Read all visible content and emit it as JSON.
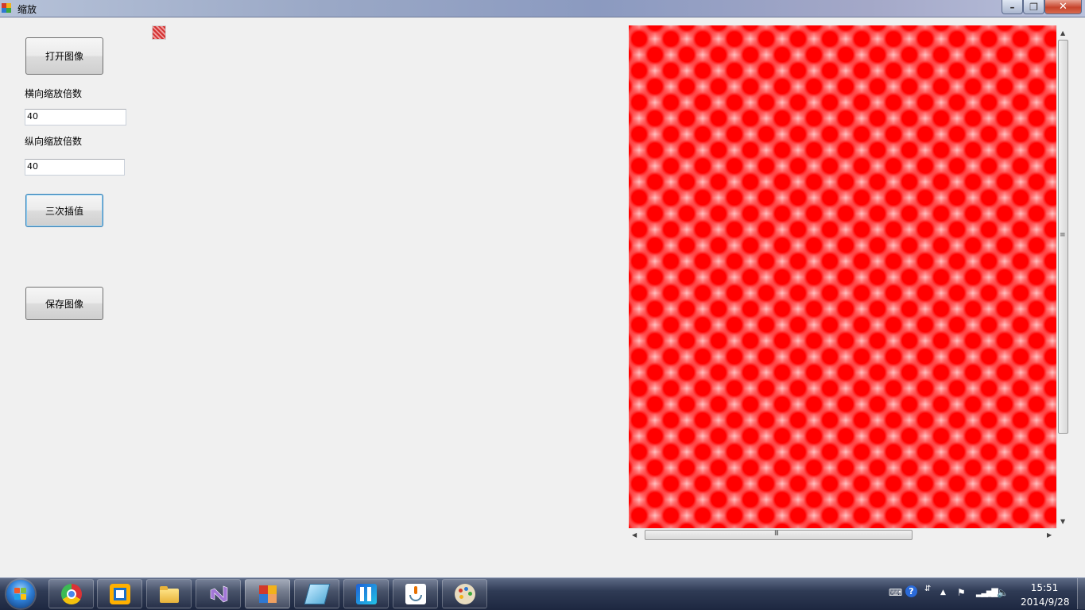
{
  "window": {
    "title": "缩放",
    "minimize_glyph": "–",
    "maximize_glyph": "❐",
    "close_glyph": "✕"
  },
  "form": {
    "open_button": "打开图像",
    "h_scale_label": "横向缩放倍数",
    "h_scale_value": "40",
    "v_scale_label": "纵向缩放倍数",
    "v_scale_value": "40",
    "bicubic_button": "三次插值",
    "save_button": "保存图像"
  },
  "scrollbars": {
    "up_arrow": "▲",
    "down_arrow": "▼",
    "left_arrow": "◀",
    "right_arrow": "▶",
    "vgrip": "≡",
    "hgrip": "III"
  },
  "taskbar": {
    "apps": [
      {
        "name": "Chrome",
        "icon": "chrome-icon"
      },
      {
        "name": "VMware",
        "icon": "vmware-icon"
      },
      {
        "name": "Explorer",
        "icon": "folder-icon"
      },
      {
        "name": "Visual Studio",
        "icon": "visual-studio-icon"
      },
      {
        "name": "缩放",
        "icon": "app-window-icon"
      },
      {
        "name": "Notepad",
        "icon": "notepad-icon"
      },
      {
        "name": "JetBrains",
        "icon": "jetbrains-icon"
      },
      {
        "name": "Java",
        "icon": "java-icon"
      },
      {
        "name": "Paint",
        "icon": "paint-icon"
      }
    ],
    "clock_time": "15:51",
    "clock_date": "2014/9/28"
  }
}
